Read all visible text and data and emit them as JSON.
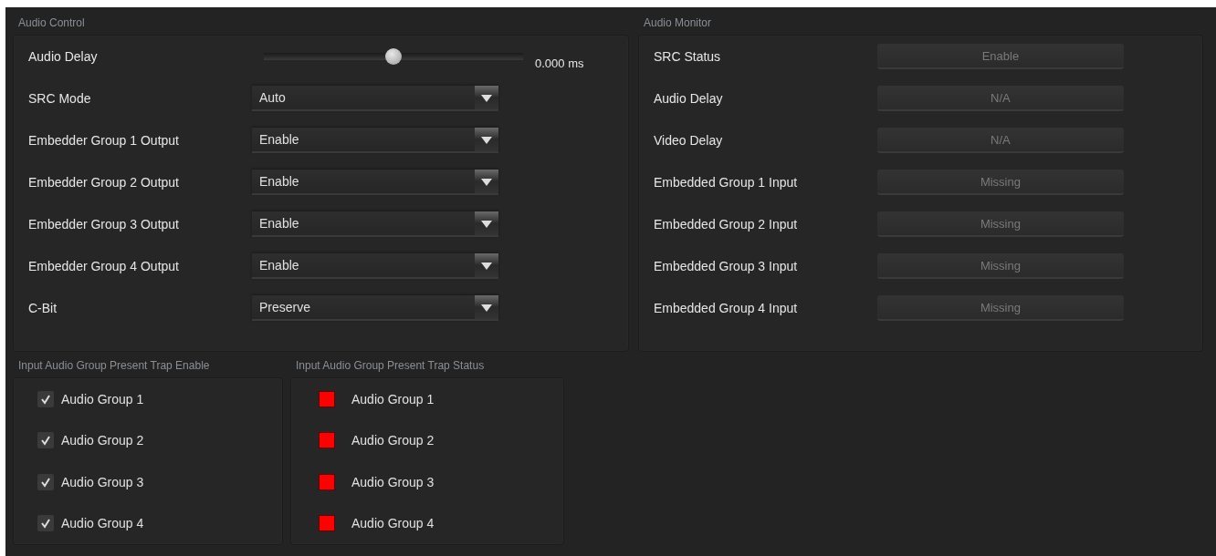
{
  "audio_control": {
    "title": "Audio Control",
    "rows": [
      {
        "kind": "slider",
        "label": "Audio Delay",
        "level": 0.5,
        "reading": "0.000 ms"
      },
      {
        "kind": "select",
        "label": "SRC Mode",
        "value": "Auto"
      },
      {
        "kind": "select",
        "label": "Embedder Group 1 Output",
        "value": "Enable"
      },
      {
        "kind": "select",
        "label": "Embedder Group 2 Output",
        "value": "Enable"
      },
      {
        "kind": "select",
        "label": "Embedder Group 3 Output",
        "value": "Enable"
      },
      {
        "kind": "select",
        "label": "Embedder Group 4 Output",
        "value": "Enable"
      },
      {
        "kind": "select",
        "label": "C-Bit",
        "value": "Preserve"
      }
    ]
  },
  "audio_monitor": {
    "title": "Audio Monitor",
    "rows": [
      {
        "label": "SRC Status",
        "value": "Enable"
      },
      {
        "label": "Audio Delay",
        "value": "N/A"
      },
      {
        "label": "Video Delay",
        "value": "N/A"
      },
      {
        "label": "Embedded Group 1 Input",
        "value": "Missing"
      },
      {
        "label": "Embedded Group 2 Input",
        "value": "Missing"
      },
      {
        "label": "Embedded Group 3 Input",
        "value": "Missing"
      },
      {
        "label": "Embedded Group 4 Input",
        "value": "Missing"
      }
    ]
  },
  "trap_enable": {
    "title": "Input Audio Group Present Trap Enable",
    "items": [
      {
        "label": "Audio Group 1",
        "checked": true
      },
      {
        "label": "Audio Group 2",
        "checked": true
      },
      {
        "label": "Audio Group 3",
        "checked": true
      },
      {
        "label": "Audio Group 4",
        "checked": true
      }
    ]
  },
  "trap_status": {
    "title": "Input Audio Group Present Trap Status",
    "items": [
      {
        "label": "Audio Group 1",
        "color": "#ff0000"
      },
      {
        "label": "Audio Group 2",
        "color": "#ff0000"
      },
      {
        "label": "Audio Group 3",
        "color": "#ff0000"
      },
      {
        "label": "Audio Group 4",
        "color": "#ff0000"
      }
    ]
  }
}
